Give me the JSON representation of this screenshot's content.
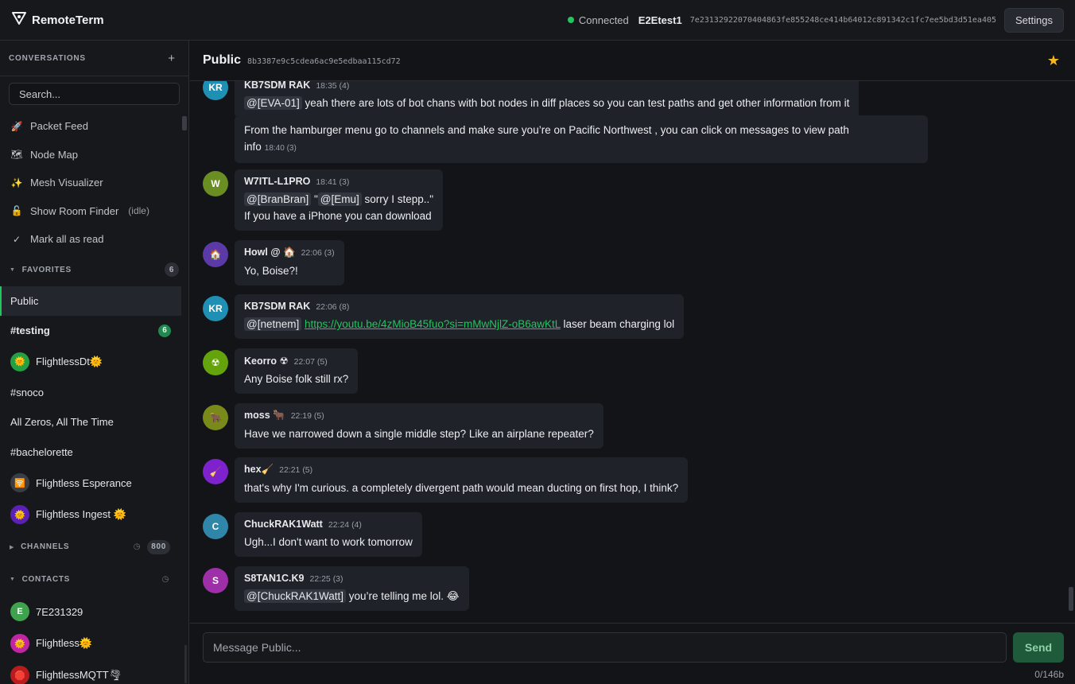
{
  "app": {
    "title": "RemoteTerm"
  },
  "status": {
    "connected_label": "Connected",
    "node_name": "E2Etest1",
    "node_key": "7e23132922070404863fe855248ce414b64012c891342c1fc7ee5bd3d51ea405",
    "settings_label": "Settings"
  },
  "sidebar": {
    "title": "CONVERSATIONS",
    "add_label": "+",
    "search_placeholder": "Search...",
    "tools": [
      {
        "label": "Packet Feed",
        "icon": "🚀",
        "sub": ""
      },
      {
        "label": "Node Map",
        "icon": "🗺",
        "sub": ""
      },
      {
        "label": "Mesh Visualizer",
        "icon": "✨",
        "sub": ""
      },
      {
        "label": "Show Room Finder",
        "icon": "🔓",
        "sub": "(idle)"
      },
      {
        "label": "Mark all as read",
        "icon": "✓",
        "sub": ""
      }
    ],
    "favorites": {
      "label": "FAVORITES",
      "count": "6",
      "items": [
        {
          "label": "Public"
        },
        {
          "label": "#testing",
          "unread": "6"
        },
        {
          "label": "FlightlessDt",
          "suffix": "🌞",
          "avatar_color": "#22a043",
          "avatar_text": "🌞"
        },
        {
          "label": "#snoco"
        },
        {
          "label": "All Zeros, All The Time"
        },
        {
          "label": "#bachelorette"
        },
        {
          "label": "Flightless Esperance",
          "avatar_color": "#3a3d44",
          "avatar_text": "🛜"
        },
        {
          "label": "Flightless Ingest",
          "suffix": "🌞",
          "avatar_color": "#5b21b6",
          "avatar_text": "🌞"
        }
      ]
    },
    "channels": {
      "label": "CHANNELS",
      "count": "800"
    },
    "contacts": {
      "label": "CONTACTS",
      "items": [
        {
          "label": "7E231329",
          "avatar_color": "#3fa34d",
          "avatar_text": "E"
        },
        {
          "label": "Flightless",
          "suffix": "🌞",
          "avatar_color": "#c026a3",
          "avatar_text": "🌞"
        },
        {
          "label": "FlightlessMQTT",
          "suffix": "🌪",
          "avatar_color": "#b91c1c",
          "avatar_text": "🛑"
        }
      ]
    }
  },
  "channel": {
    "name": "Public",
    "key": "8b3387e9c5cdea6ac9e5edbaa115cd72",
    "favorite_icon": "★"
  },
  "messages": [
    {
      "avatar": "KR",
      "color": "#1f8fb3",
      "sender": "KB7SDM RAK",
      "time": "18:35",
      "hops": "(4)",
      "parts": [
        {
          "mention": "@[EVA-01]"
        },
        {
          "text": " yeah there are lots of bot chans with bot nodes in diff places so you can test paths and get other information from it"
        }
      ]
    },
    {
      "continuation": true,
      "text1": "From the hamburger menu go to channels and make sure you’re on Pacific Northwest , you can click on messages to view path",
      "text2": "info",
      "time": "18:40",
      "hops": "(3)"
    },
    {
      "avatar": "W",
      "color": "#6b8e23",
      "sender": "W7ITL-L1PRO",
      "time": "18:41",
      "hops": "(3)",
      "line1": [
        {
          "mention": "@[BranBran]"
        },
        {
          "text": " \""
        },
        {
          "mention": "@[Emu]"
        },
        {
          "text": " sorry I stepp..\""
        }
      ],
      "line2": "If you have a iPhone you can download"
    },
    {
      "avatar": "🏠",
      "color": "#5b3aa8",
      "sender": "Howl @ 🏠",
      "time": "22:06",
      "hops": "(3)",
      "text": "Yo, Boise?!"
    },
    {
      "avatar": "KR",
      "color": "#1f8fb3",
      "sender": "KB7SDM RAK",
      "time": "22:06",
      "hops": "(8)",
      "mention": "@[netnem]",
      "link": "https://youtu.be/4zMioB45fuo?si=mMwNjlZ-oB6awKtL",
      "after": " laser beam charging lol"
    },
    {
      "avatar": "☢",
      "color": "#65a30d",
      "sender": "Keorro ☢",
      "time": "22:07",
      "hops": "(5)",
      "text": "Any Boise folk still rx?"
    },
    {
      "avatar": "🐂",
      "color": "#7a8a1a",
      "sender": "moss 🐂",
      "time": "22:19",
      "hops": "(5)",
      "text": "Have we narrowed down a single middle step? Like an airplane repeater?"
    },
    {
      "avatar": "🧹",
      "color": "#7e22ce",
      "sender": "hex🧹",
      "time": "22:21",
      "hops": "(5)",
      "text": "that's why I'm curious. a completely divergent path would mean ducting on first hop, I think?"
    },
    {
      "avatar": "C",
      "color": "#2f86a8",
      "sender": "ChuckRAK1Watt",
      "time": "22:24",
      "hops": "(4)",
      "text": "Ugh...I don't want to work tomorrow"
    },
    {
      "avatar": "S",
      "color": "#9d2fa8",
      "sender": "S8TAN1C.K9",
      "time": "22:25",
      "hops": "(3)",
      "mention": "@[ChuckRAK1Watt]",
      "after": " you’re telling me lol. 😂"
    }
  ],
  "composer": {
    "placeholder": "Message Public...",
    "send_label": "Send",
    "byte_count": "0/146b"
  }
}
